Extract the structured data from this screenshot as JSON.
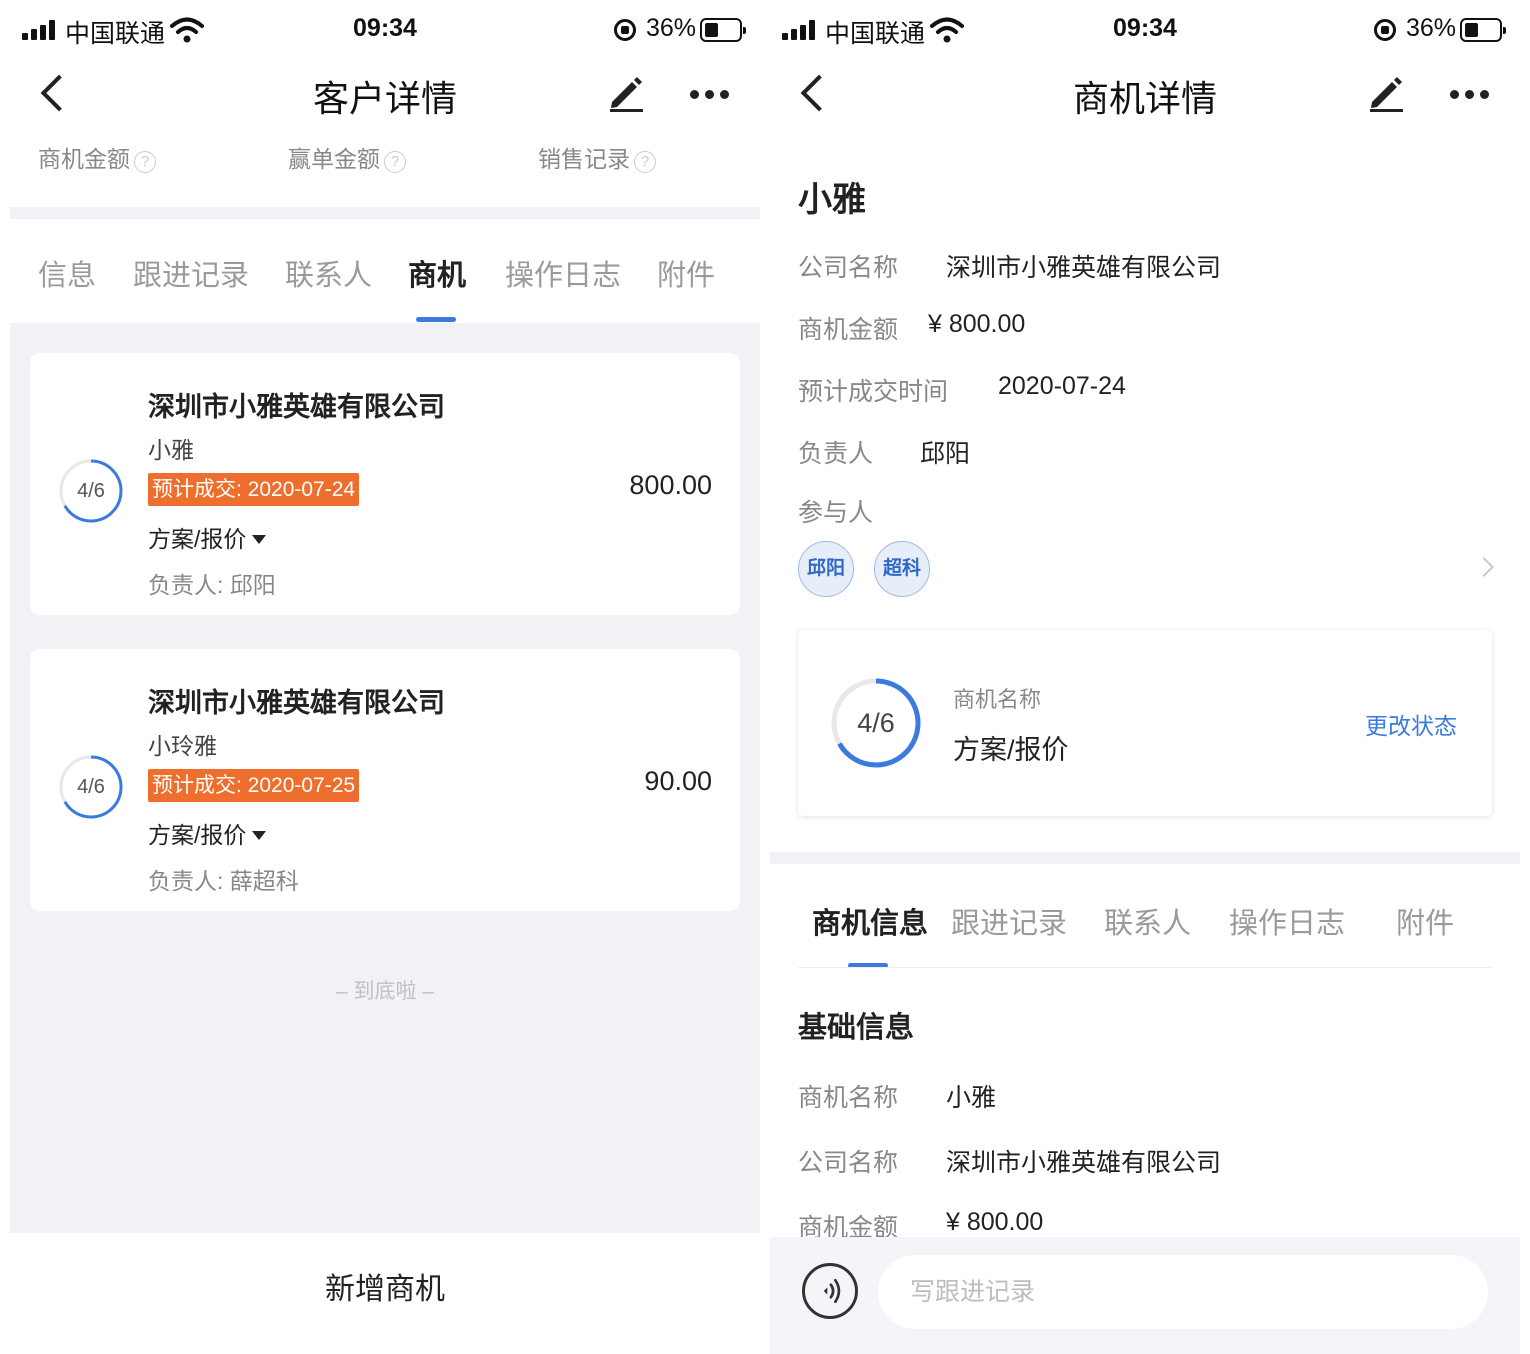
{
  "left": {
    "status": {
      "carrier": "中国联通",
      "time": "09:34",
      "battery": "36%"
    },
    "nav": {
      "title": "客户详情"
    },
    "stats": [
      {
        "label": "商机金额"
      },
      {
        "label": "赢单金额"
      },
      {
        "label": "销售记录"
      }
    ],
    "tabs": [
      {
        "label": "信息"
      },
      {
        "label": "跟进记录"
      },
      {
        "label": "联系人"
      },
      {
        "label": "商机",
        "active": true
      },
      {
        "label": "操作日志"
      },
      {
        "label": "附件"
      }
    ],
    "cards": [
      {
        "progress": "4/6",
        "progress_fraction": 0.667,
        "company": "深圳市小雅英雄有限公司",
        "contact": "小雅",
        "expected": "预计成交: 2020-07-24",
        "stage": "方案/报价",
        "owner": "负责人:  邱阳",
        "amount": "800.00"
      },
      {
        "progress": "4/6",
        "progress_fraction": 0.667,
        "company": "深圳市小雅英雄有限公司",
        "contact": "小玲雅",
        "expected": "预计成交: 2020-07-25",
        "stage": "方案/报价",
        "owner": "负责人:  薛超科",
        "amount": "90.00"
      }
    ],
    "list_end": "– 到底啦 –",
    "bottom_button": "新增商机"
  },
  "right": {
    "status": {
      "carrier": "中国联通",
      "time": "09:34",
      "battery": "36%"
    },
    "nav": {
      "title": "商机详情"
    },
    "name": "小雅",
    "fields": [
      {
        "label": "公司名称",
        "value": "深圳市小雅英雄有限公司"
      },
      {
        "label": "商机金额",
        "value": "¥ 800.00"
      },
      {
        "label": "预计成交时间",
        "value": "2020-07-24"
      },
      {
        "label": "负责人",
        "value": "邱阳"
      }
    ],
    "participants_label": "参与人",
    "participants": [
      "邱阳",
      "超科"
    ],
    "stage_card": {
      "progress": "4/6",
      "progress_fraction": 0.667,
      "label": "商机名称",
      "value": "方案/报价",
      "action": "更改状态"
    },
    "tabs": [
      {
        "label": "商机信息",
        "active": true
      },
      {
        "label": "跟进记录"
      },
      {
        "label": "联系人"
      },
      {
        "label": "操作日志"
      },
      {
        "label": "附件"
      }
    ],
    "section_title": "基础信息",
    "basic_fields": [
      {
        "label": "商机名称",
        "value": "小雅"
      },
      {
        "label": "公司名称",
        "value": "深圳市小雅英雄有限公司"
      },
      {
        "label": "商机金额",
        "value": "¥ 800.00"
      }
    ],
    "footer": {
      "placeholder": "写跟进记录"
    }
  },
  "colors": {
    "accent": "#3b7be0",
    "badge": "#ee6f2d",
    "band": "#f1f2f5"
  }
}
